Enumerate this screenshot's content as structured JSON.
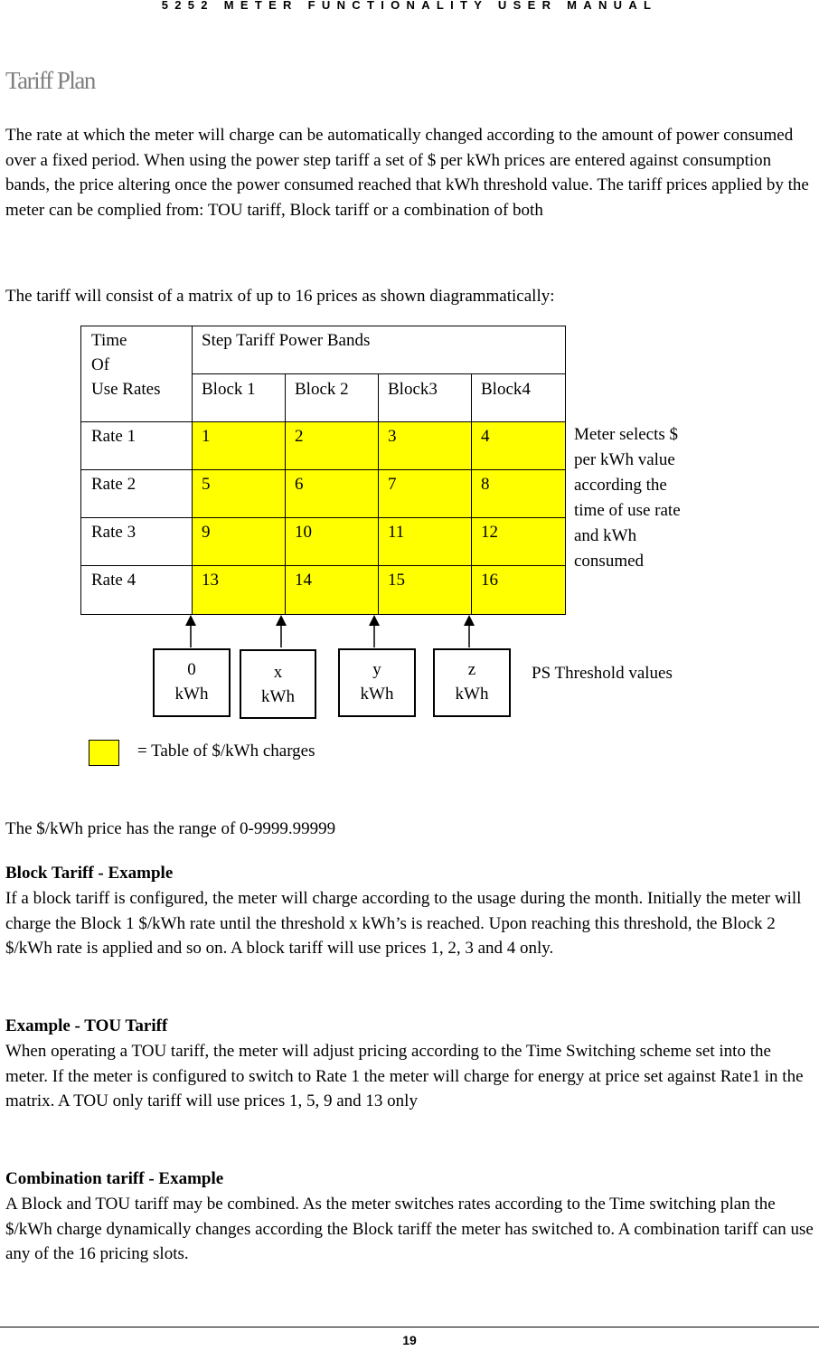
{
  "header": {
    "running_title": "5252 METER FUNCTIONALITY USER MANUAL"
  },
  "section": {
    "title": "Tariff Plan"
  },
  "intro": {
    "p1": "The rate at which the meter will charge can be automatically changed according to the amount of power consumed over a fixed period. When using the power step tariff a set of $ per kWh prices are entered against consumption bands, the price altering once the power consumed reached that kWh threshold value. The tariff prices applied by the meter can be complied from: TOU tariff, Block tariff or a combination of both",
    "p2": "The tariff will consist of a matrix of up to 16 prices as shown diagrammatically:"
  },
  "diagram": {
    "corner_label": [
      "Time",
      "Of",
      "Use Rates"
    ],
    "bands_header": "Step Tariff Power Bands",
    "blocks": [
      "Block 1",
      "Block 2",
      "Block3",
      "Block4"
    ],
    "rows": [
      {
        "rate": "Rate 1",
        "prices": [
          "1",
          "2",
          "3",
          "4"
        ]
      },
      {
        "rate": "Rate 2",
        "prices": [
          "5",
          "6",
          "7",
          "8"
        ]
      },
      {
        "rate": "Rate 3",
        "prices": [
          "9",
          "10",
          "11",
          "12"
        ]
      },
      {
        "rate": "Rate 4",
        "prices": [
          "13",
          "14",
          "15",
          "16"
        ]
      }
    ],
    "side_note": [
      "Meter selects $",
      "per kWh value",
      "according the",
      "time of use rate",
      "and kWh",
      "consumed"
    ],
    "thresholds": [
      {
        "value": "0",
        "unit": "kWh"
      },
      {
        "value": "x",
        "unit": "kWh"
      },
      {
        "value": "y",
        "unit": "kWh"
      },
      {
        "value": "z",
        "unit": "kWh"
      }
    ],
    "thresholds_label": "PS Threshold values",
    "legend_text": "= Table of $/kWh charges",
    "highlight_color": "#ffff00"
  },
  "range_note": "The $/kWh price has the range of 0-9999.99999",
  "examples": [
    {
      "heading": "Block Tariff - Example",
      "body": "If a block tariff is configured, the meter will charge according to the usage during the month. Initially the meter will charge the Block 1 $/kWh rate until the threshold x kWh’s is reached. Upon reaching this threshold, the Block 2 $/kWh rate is applied and so on. A block tariff will use prices 1, 2, 3 and 4 only."
    },
    {
      "heading": "Example - TOU Tariff",
      "body": "When operating a TOU tariff, the meter will adjust pricing according to the Time Switching scheme set into the meter. If the meter is configured to switch to Rate 1 the meter will charge for energy at price set against Rate1 in the matrix. A TOU only tariff will use prices 1, 5, 9 and 13 only"
    },
    {
      "heading": "Combination tariff - Example",
      "body": "A Block and TOU tariff may be combined. As the meter switches rates according to the Time switching plan the $/kWh charge dynamically changes according the Block tariff the meter has switched to. A combination tariff can use any of the 16 pricing slots."
    }
  ],
  "footer": {
    "page_number": "19"
  }
}
